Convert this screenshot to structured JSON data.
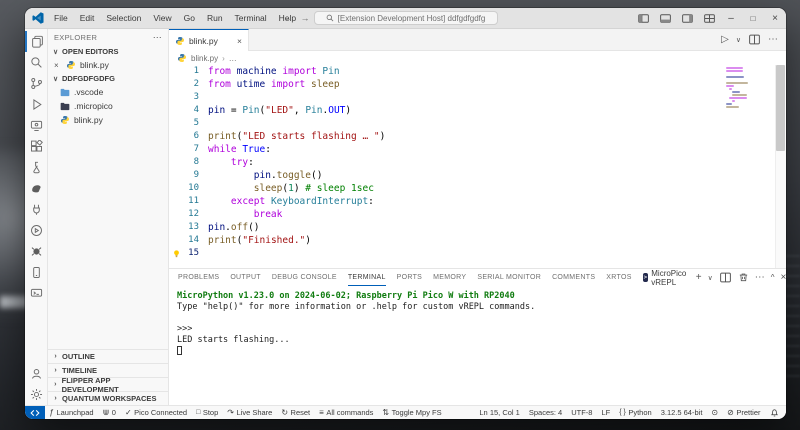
{
  "titlebar": {
    "menus": [
      "File",
      "Edit",
      "Selection",
      "View",
      "Go",
      "Run",
      "Terminal",
      "Help"
    ],
    "search_text": "[Extension Development Host] ddfgdfgdfg",
    "window_controls": [
      "layout-sidebar-left",
      "layout-panel",
      "layout-sidebar-right",
      "customize-layout",
      "minimize",
      "maximize",
      "close"
    ]
  },
  "activity_bar": {
    "top": [
      "explorer",
      "search",
      "source-control",
      "run-debug",
      "remote-explorer",
      "extensions",
      "testing",
      "flipper",
      "pymakr",
      "micropico",
      "spider",
      "device-manager",
      "serial-monitor"
    ],
    "bottom": [
      "account",
      "settings"
    ]
  },
  "sidebar": {
    "title": "EXPLORER",
    "open_editors_label": "OPEN EDITORS",
    "open_editor_file": "blink.py",
    "workspace_label": "DDFGDFGDFG",
    "files": [
      {
        "name": ".vscode",
        "icon": "folder-vscode"
      },
      {
        "name": ".micropico",
        "icon": "folder-dark"
      },
      {
        "name": "blink.py",
        "icon": "python"
      }
    ],
    "bottom_sections": [
      "OUTLINE",
      "TIMELINE",
      "FLIPPER APP DEVELOPMENT",
      "QUANTUM WORKSPACES"
    ]
  },
  "editor": {
    "tab_label": "blink.py",
    "breadcrumb": [
      "blink.py",
      "…"
    ],
    "actions": [
      "run-python-file",
      "run-dropdown",
      "split-editor",
      "more-actions"
    ],
    "code_lines": [
      {
        "n": 1,
        "parts": [
          [
            "kw",
            "from "
          ],
          [
            "ns",
            "machine"
          ],
          [
            "kw",
            " import "
          ],
          [
            "cls",
            "Pin"
          ]
        ]
      },
      {
        "n": 2,
        "parts": [
          [
            "kw",
            "from "
          ],
          [
            "ns",
            "utime"
          ],
          [
            "kw",
            " import "
          ],
          [
            "fn",
            "sleep"
          ]
        ]
      },
      {
        "n": 3,
        "parts": []
      },
      {
        "n": 4,
        "parts": [
          [
            "ns",
            "pin"
          ],
          [
            "def",
            " = "
          ],
          [
            "cls",
            "Pin"
          ],
          [
            "def",
            "("
          ],
          [
            "str",
            "\"LED\""
          ],
          [
            "def",
            ", "
          ],
          [
            "cls",
            "Pin"
          ],
          [
            "def",
            "."
          ],
          [
            "kw2",
            "OUT"
          ],
          [
            "def",
            ")"
          ]
        ]
      },
      {
        "n": 5,
        "parts": []
      },
      {
        "n": 6,
        "parts": [
          [
            "fn",
            "print"
          ],
          [
            "def",
            "("
          ],
          [
            "str",
            "\"LED starts flashing … \""
          ],
          [
            "def",
            ")"
          ]
        ]
      },
      {
        "n": 7,
        "parts": [
          [
            "kw",
            "while "
          ],
          [
            "kw2",
            "True"
          ],
          [
            "def",
            ":"
          ]
        ]
      },
      {
        "n": 8,
        "parts": [
          [
            "def",
            "    "
          ],
          [
            "kw",
            "try"
          ],
          [
            "def",
            ":"
          ]
        ]
      },
      {
        "n": 9,
        "parts": [
          [
            "def",
            "        "
          ],
          [
            "ns",
            "pin"
          ],
          [
            "def",
            "."
          ],
          [
            "fn",
            "toggle"
          ],
          [
            "def",
            "()"
          ]
        ]
      },
      {
        "n": 10,
        "parts": [
          [
            "def",
            "        "
          ],
          [
            "fn",
            "sleep"
          ],
          [
            "def",
            "("
          ],
          [
            "num",
            "1"
          ],
          [
            "def",
            ") "
          ],
          [
            "cmt",
            "# sleep 1sec"
          ]
        ]
      },
      {
        "n": 11,
        "parts": [
          [
            "def",
            "    "
          ],
          [
            "kw",
            "except "
          ],
          [
            "cls",
            "KeyboardInterrupt"
          ],
          [
            "def",
            ":"
          ]
        ]
      },
      {
        "n": 12,
        "parts": [
          [
            "def",
            "        "
          ],
          [
            "kw",
            "break"
          ]
        ]
      },
      {
        "n": 13,
        "parts": [
          [
            "ns",
            "pin"
          ],
          [
            "def",
            "."
          ],
          [
            "fn",
            "off"
          ],
          [
            "def",
            "()"
          ]
        ]
      },
      {
        "n": 14,
        "parts": [
          [
            "fn",
            "print"
          ],
          [
            "def",
            "("
          ],
          [
            "str",
            "\"Finished.\""
          ],
          [
            "def",
            ")"
          ]
        ]
      },
      {
        "n": 15,
        "parts": [],
        "current": true,
        "lightbulb": true
      }
    ]
  },
  "panel": {
    "tabs": [
      "PROBLEMS",
      "OUTPUT",
      "DEBUG CONSOLE",
      "TERMINAL",
      "PORTS",
      "MEMORY",
      "SERIAL MONITOR",
      "COMMENTS",
      "XRTOS"
    ],
    "active_tab": "TERMINAL",
    "terminal_name": "MicroPico vREPL",
    "toolbar": [
      "new-terminal",
      "terminal-dropdown",
      "split-terminal",
      "kill-terminal",
      "more-actions",
      "maximize-panel",
      "close-panel"
    ],
    "terminal_lines": [
      {
        "cls": "green",
        "text": "MicroPython v1.23.0 on 2024-06-02; Raspberry Pi Pico W with RP2040"
      },
      {
        "cls": "plain",
        "text": "Type \"help()\" for more information or .help for custom vREPL commands."
      },
      {
        "cls": "plain",
        "text": ""
      },
      {
        "cls": "plain",
        "text": ">>>"
      },
      {
        "cls": "plain",
        "text": "LED starts flashing..."
      },
      {
        "cls": "plain",
        "text": "",
        "cursor": true
      }
    ]
  },
  "status_bar": {
    "accent_color": "#005FB8",
    "left": [
      {
        "id": "remote-indicator",
        "icon": "remote",
        "label": "",
        "accent": true
      },
      {
        "id": "launchpad",
        "icon": "flipper",
        "label": "Launchpad"
      },
      {
        "id": "dolphin-counter",
        "icon": "dolphin",
        "label": "0"
      },
      {
        "id": "pico-connected",
        "icon": "check",
        "label": "Pico Connected"
      },
      {
        "id": "stop",
        "icon": "stop",
        "label": "Stop"
      },
      {
        "id": "live-share",
        "icon": "share",
        "label": "Live Share"
      },
      {
        "id": "reset",
        "icon": "reset",
        "label": "Reset"
      },
      {
        "id": "all-commands",
        "icon": "list",
        "label": "All commands"
      },
      {
        "id": "toggle-mpy-fs",
        "icon": "toggle",
        "label": "Toggle Mpy FS"
      }
    ],
    "right": [
      {
        "id": "cursor-position",
        "label": "Ln 15, Col 1"
      },
      {
        "id": "indentation",
        "label": "Spaces: 4"
      },
      {
        "id": "encoding",
        "label": "UTF-8"
      },
      {
        "id": "eol",
        "label": "LF"
      },
      {
        "id": "language-mode",
        "icon": "braces",
        "label": "Python"
      },
      {
        "id": "python-version",
        "label": "3.12.5 64-bit"
      },
      {
        "id": "bug",
        "icon": "bug",
        "label": ""
      },
      {
        "id": "prettier",
        "icon": "slash",
        "label": "Prettier"
      },
      {
        "id": "notifications",
        "icon": "bell",
        "label": ""
      }
    ]
  }
}
